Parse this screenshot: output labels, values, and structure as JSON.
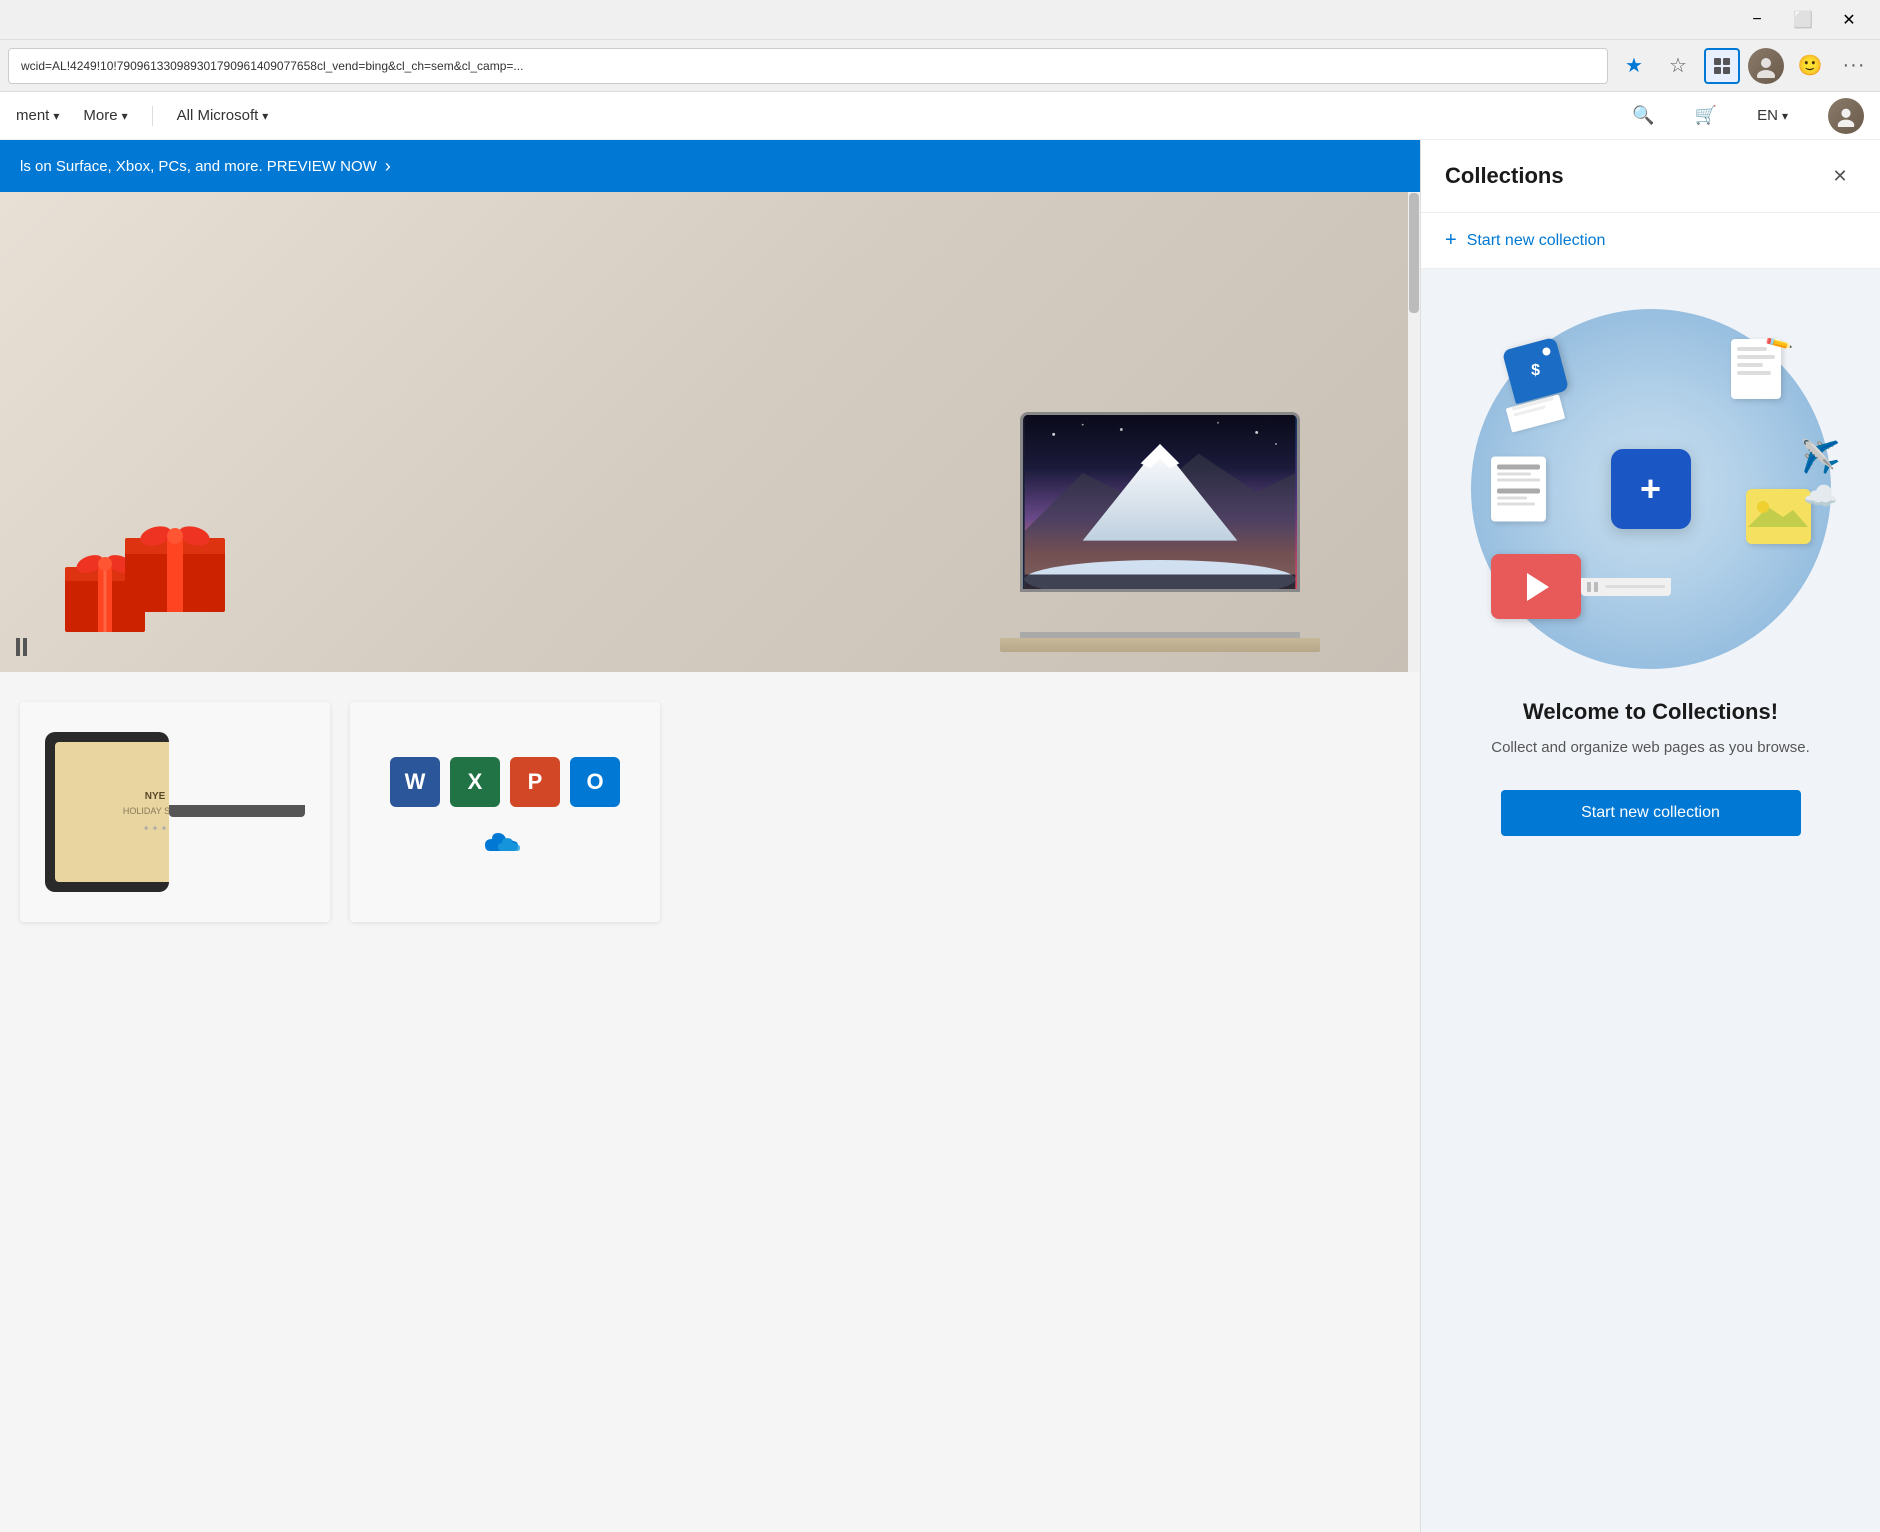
{
  "titlebar": {
    "minimize_label": "−",
    "maximize_label": "⬜",
    "close_label": "✕"
  },
  "addressbar": {
    "url": "wcid=AL!4249!10!790961330989301790961409077658cl_vend=bing&cl_ch=sem&cl_camp=...",
    "favorite_icon": "★",
    "reading_list_icon": "☆",
    "collections_icon": "⊞",
    "more_icon": "···"
  },
  "navbar": {
    "management_label": "ment",
    "more_label": "More",
    "all_microsoft_label": "All Microsoft",
    "search_icon": "🔍",
    "cart_icon": "🛒",
    "lang_label": "EN"
  },
  "promo_banner": {
    "text": "ls on Surface, Xbox, PCs, and more. PREVIEW NOW",
    "arrow": "›"
  },
  "collections_panel": {
    "title": "Collections",
    "close_label": "✕",
    "new_collection_label": "Start new collection",
    "plus_icon": "+",
    "welcome_title": "Welcome to Collections!",
    "welcome_subtitle": "Collect and organize web pages as\nyou browse.",
    "start_btn_label": "Start new collection"
  },
  "illustration": {
    "center_icon": "+",
    "price_text": "$",
    "pencil_icon": "✏",
    "plane_emoji": "✈",
    "cloud_emoji": "☁"
  },
  "products": {
    "card1_alt": "NYE Surface tablet",
    "card2_alt": "Microsoft Office apps"
  }
}
